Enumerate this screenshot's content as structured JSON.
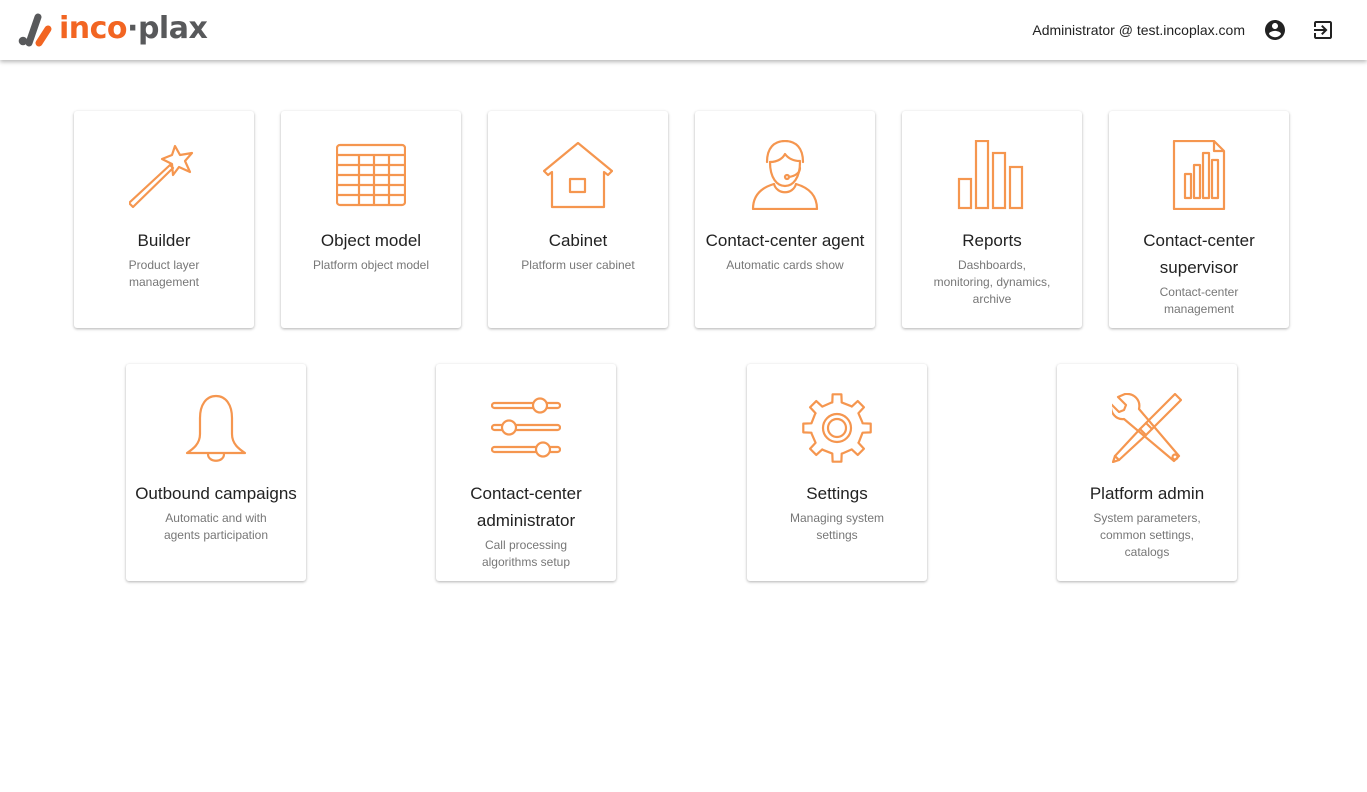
{
  "brand": {
    "name_part1": "inco",
    "separator": "·",
    "name_part2": "plax",
    "accent_color": "#f26522",
    "secondary_color": "#58595b"
  },
  "header": {
    "user": "Administrator @ test.incoplax.com",
    "account_icon": "account-circle-icon",
    "logout_icon": "logout-icon"
  },
  "icon_color": "#f5964f",
  "modules": [
    {
      "title": "Builder",
      "description": "Product layer management",
      "icon": "magic-wand-icon"
    },
    {
      "title": "Object model",
      "description": "Platform object model",
      "icon": "table-grid-icon"
    },
    {
      "title": "Cabinet",
      "description": "Platform user cabinet",
      "icon": "house-icon"
    },
    {
      "title": "Contact-center agent",
      "description": "Automatic cards show",
      "icon": "headset-agent-icon"
    },
    {
      "title": "Reports",
      "description": "Dashboards, monitoring, dynamics, archive",
      "icon": "bar-chart-icon"
    },
    {
      "title": "Contact-center supervisor",
      "description": "Contact-center management",
      "icon": "report-document-icon"
    },
    {
      "title": "Outbound campaigns",
      "description": "Automatic and with agents participation",
      "icon": "bell-icon"
    },
    {
      "title": "Contact-center administrator",
      "description": "Call processing algorithms setup",
      "icon": "sliders-icon"
    },
    {
      "title": "Settings",
      "description": "Managing system settings",
      "icon": "gear-icon"
    },
    {
      "title": "Platform admin",
      "description": "System parameters, common settings, catalogs",
      "icon": "wrench-screwdriver-icon"
    }
  ]
}
